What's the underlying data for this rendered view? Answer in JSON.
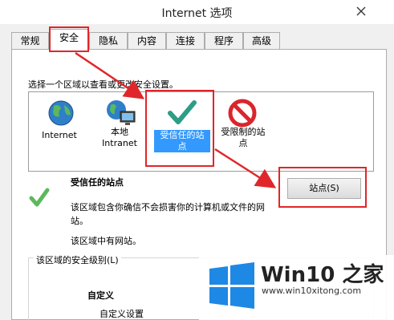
{
  "window": {
    "title": "Internet 选项"
  },
  "tabs": [
    {
      "label": "常规"
    },
    {
      "label": "安全"
    },
    {
      "label": "隐私"
    },
    {
      "label": "内容"
    },
    {
      "label": "连接"
    },
    {
      "label": "程序"
    },
    {
      "label": "高级"
    }
  ],
  "security": {
    "instruction": "选择一个区域以查看或更改安全设置。",
    "zones": [
      {
        "name": "Internet",
        "icon": "globe-icon"
      },
      {
        "name": "本地\nIntranet",
        "icon": "intranet-icon"
      },
      {
        "name": "受信任的站\n点",
        "icon": "checkmark-icon",
        "selected": true
      },
      {
        "name": "受限制的站\n点",
        "icon": "restricted-icon"
      }
    ],
    "zone_title": "受信任的站点",
    "zone_desc": "该区域包含你确信不会损害你的计算机或文件的网\n站。",
    "zone_has_sites": "该区域中有网站。",
    "sites_button": "站点(S)",
    "level_group": "该区域的安全级别(L)",
    "level_name": "自定义",
    "level_desc": "自定义设置"
  },
  "watermark": {
    "name": "Win10 之家",
    "url": "www.win10xitong.com"
  },
  "colors": {
    "selection": "#3399ff",
    "annotation_red": "#e0262a",
    "logo_blue": "#1e88e5"
  }
}
